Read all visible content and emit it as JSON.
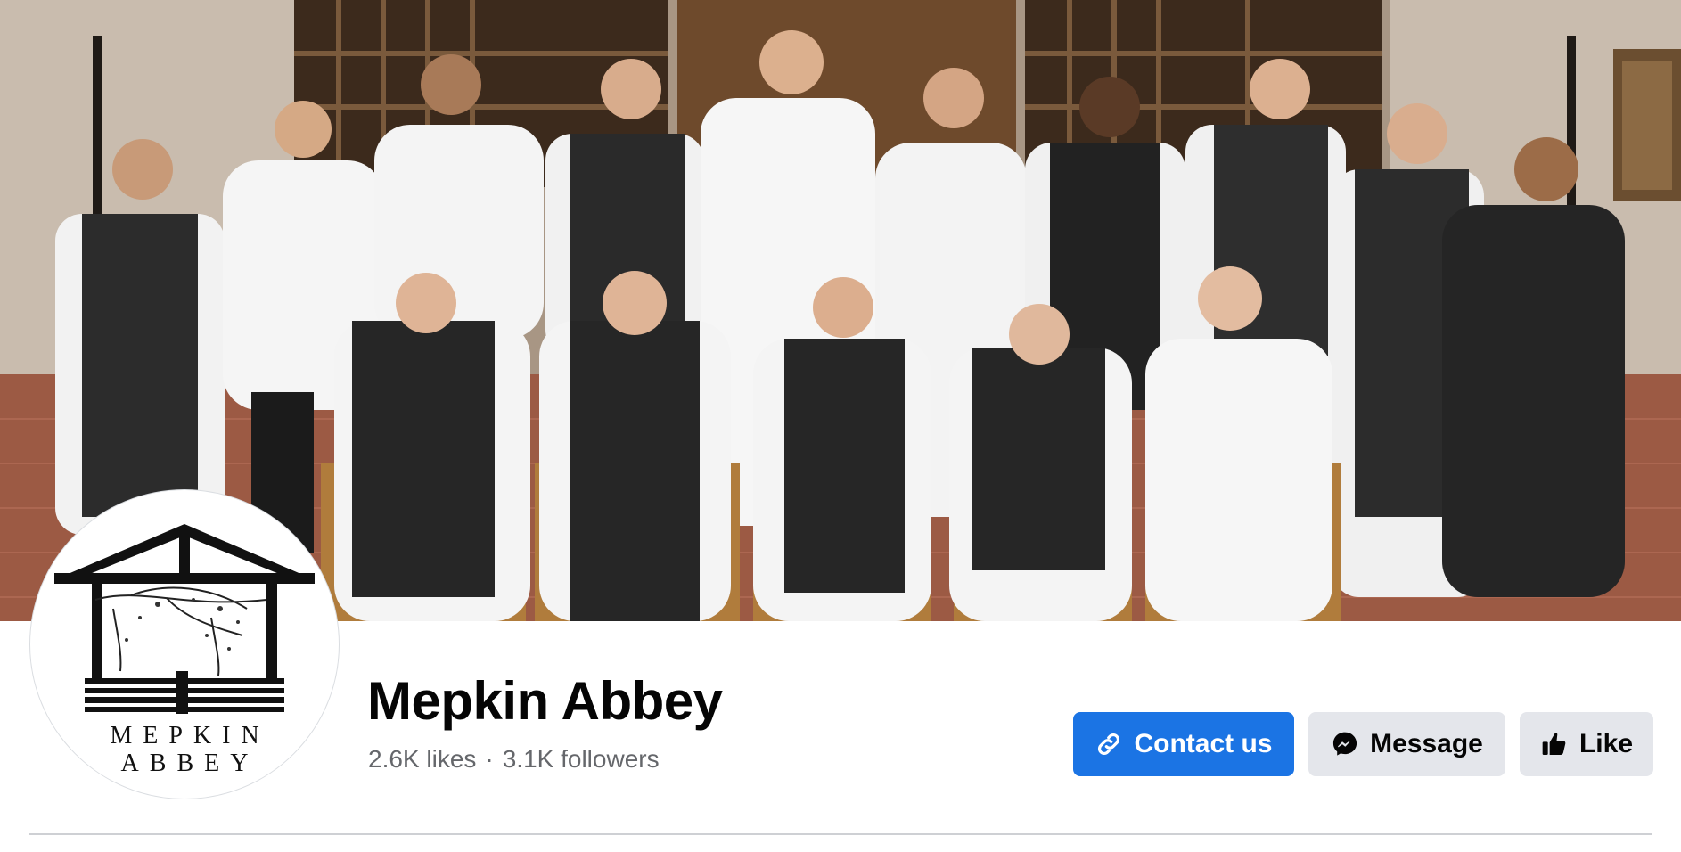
{
  "cover": {
    "description_icon": "cover-photo"
  },
  "profile": {
    "logo_line1": "MEPKIN",
    "logo_line2": "ABBEY",
    "name": "Mepkin Abbey",
    "likes": "2.6K likes",
    "separator": "·",
    "followers": "3.1K followers"
  },
  "actions": {
    "contact_label": "Contact us",
    "contact_icon": "link-icon",
    "message_label": "Message",
    "message_icon": "messenger-icon",
    "like_label": "Like",
    "like_icon": "thumbs-up-icon"
  },
  "colors": {
    "primary": "#1b74e4",
    "secondary_bg": "#e4e6eb",
    "muted_text": "#65676b"
  }
}
